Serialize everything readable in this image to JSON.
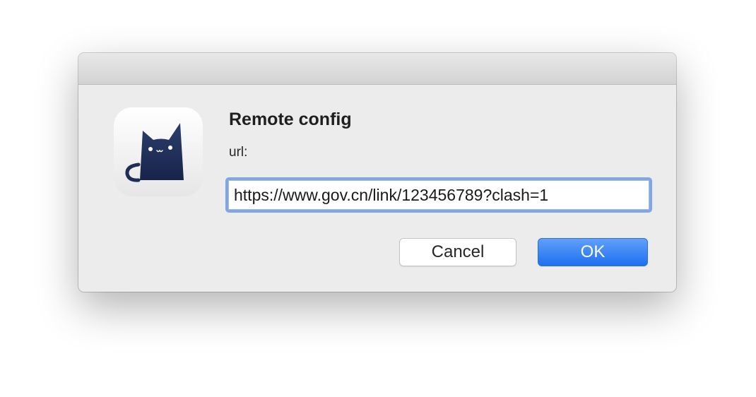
{
  "dialog": {
    "title": "Remote config",
    "field_label": "url:",
    "url_value": "https://www.gov.cn/link/123456789?clash=1",
    "app_icon": "clash-cat-icon",
    "buttons": {
      "cancel_label": "Cancel",
      "ok_label": "OK"
    }
  },
  "colors": {
    "accent": "#2f7bf5",
    "focus_ring": "#7fa7e8",
    "icon_cat": "#1e2f56"
  }
}
